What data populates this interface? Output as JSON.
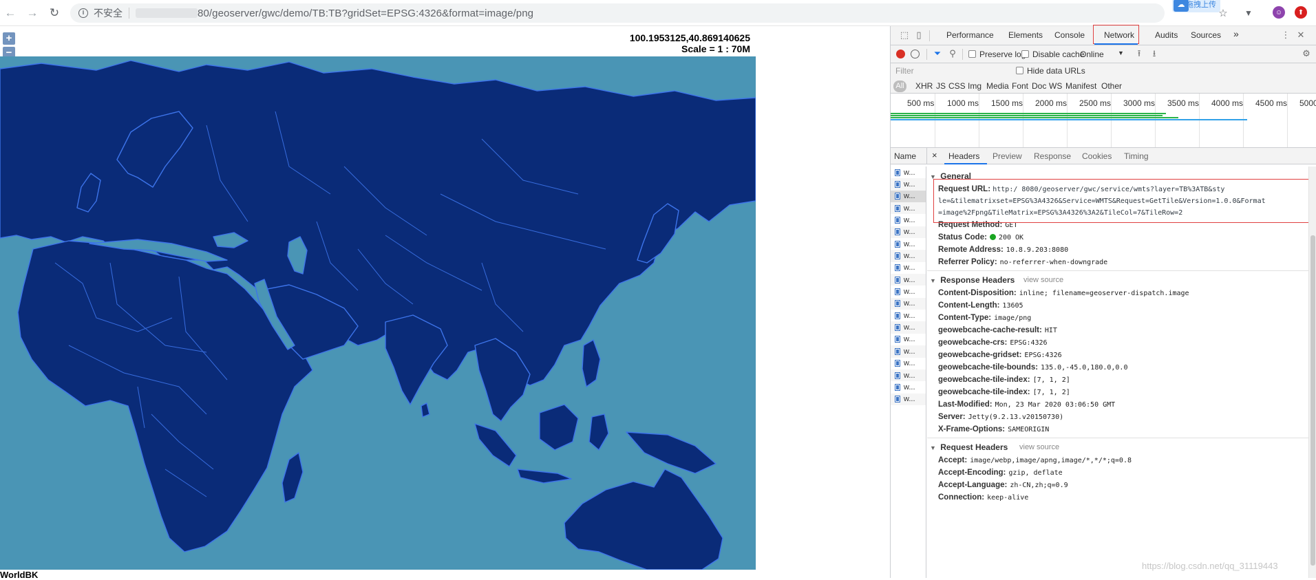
{
  "browser": {
    "insecure_label": "不安全",
    "url": "80/geoserver/gwc/demo/TB:TB?gridSet=EPSG:4326&format=image/png",
    "upload_label": "拖拽上传"
  },
  "map": {
    "zoom_in": "+",
    "zoom_out": "−",
    "coordinates": "100.1953125,40.869140625",
    "scale": "Scale = 1 : 70M",
    "layer_name": "WorldBK",
    "colors": {
      "ocean": "#4a95b5",
      "land": "#0a2b78",
      "borders": "#3d74ea"
    }
  },
  "devtools": {
    "tabs": [
      "Performance",
      "Elements",
      "Console",
      "Network",
      "Audits",
      "Sources"
    ],
    "more": "»",
    "toolbar": {
      "preserve_log": "Preserve log",
      "disable_cache": "Disable cache",
      "throttling": "Online"
    },
    "filter_placeholder": "Filter",
    "hide_data_urls": "Hide data URLs",
    "filter_types": [
      "All",
      "XHR",
      "JS",
      "CSS",
      "Img",
      "Media",
      "Font",
      "Doc",
      "WS",
      "Manifest",
      "Other"
    ],
    "timeline_labels": [
      "500 ms",
      "1000 ms",
      "1500 ms",
      "2000 ms",
      "2500 ms",
      "3000 ms",
      "3500 ms",
      "4000 ms",
      "4500 ms",
      "5000"
    ],
    "name_header": "Name",
    "close": "×",
    "detail_tabs": [
      "Headers",
      "Preview",
      "Response",
      "Cookies",
      "Timing"
    ],
    "request_row_label": "w...",
    "request_row_count": 20,
    "general": {
      "title": "General",
      "request_url_key": "Request URL:",
      "request_url_lines": [
        "http:/          8080/geoserver/gwc/service/wmts?layer=TB%3ATB&sty",
        "le=&tilematrixset=EPSG%3A4326&Service=WMTS&Request=GetTile&Version=1.0.0&Format",
        "=image%2Fpng&TileMatrix=EPSG%3A4326%3A2&TileCol=7&TileRow=2"
      ],
      "method_key": "Request Method:",
      "method_val": "GET",
      "status_key": "Status Code:",
      "status_val": "200 OK",
      "remote_key": "Remote Address:",
      "remote_val": "10.8.9.203:8080",
      "referrer_key": "Referrer Policy:",
      "referrer_val": "no-referrer-when-downgrade"
    },
    "response_headers": {
      "title": "Response Headers",
      "view_source": "view source",
      "items": [
        {
          "k": "Content-Disposition:",
          "v": "inline; filename=geoserver-dispatch.image"
        },
        {
          "k": "Content-Length:",
          "v": "13605"
        },
        {
          "k": "Content-Type:",
          "v": "image/png"
        },
        {
          "k": "geowebcache-cache-result:",
          "v": "HIT"
        },
        {
          "k": "geowebcache-crs:",
          "v": "EPSG:4326"
        },
        {
          "k": "geowebcache-gridset:",
          "v": "EPSG:4326"
        },
        {
          "k": "geowebcache-tile-bounds:",
          "v": "135.0,-45.0,180.0,0.0"
        },
        {
          "k": "geowebcache-tile-index:",
          "v": "[7, 1, 2]"
        },
        {
          "k": "geowebcache-tile-index:",
          "v": "[7, 1, 2]"
        },
        {
          "k": "Last-Modified:",
          "v": "Mon, 23 Mar 2020 03:06:50 GMT"
        },
        {
          "k": "Server:",
          "v": "Jetty(9.2.13.v20150730)"
        },
        {
          "k": "X-Frame-Options:",
          "v": "SAMEORIGIN"
        }
      ]
    },
    "request_headers": {
      "title": "Request Headers",
      "view_source": "view source",
      "items": [
        {
          "k": "Accept:",
          "v": "image/webp,image/apng,image/*,*/*;q=0.8"
        },
        {
          "k": "Accept-Encoding:",
          "v": "gzip, deflate"
        },
        {
          "k": "Accept-Language:",
          "v": "zh-CN,zh;q=0.9"
        },
        {
          "k": "Connection:",
          "v": "keep-alive"
        }
      ]
    }
  },
  "watermark": "https://blog.csdn.net/qq_31119443"
}
